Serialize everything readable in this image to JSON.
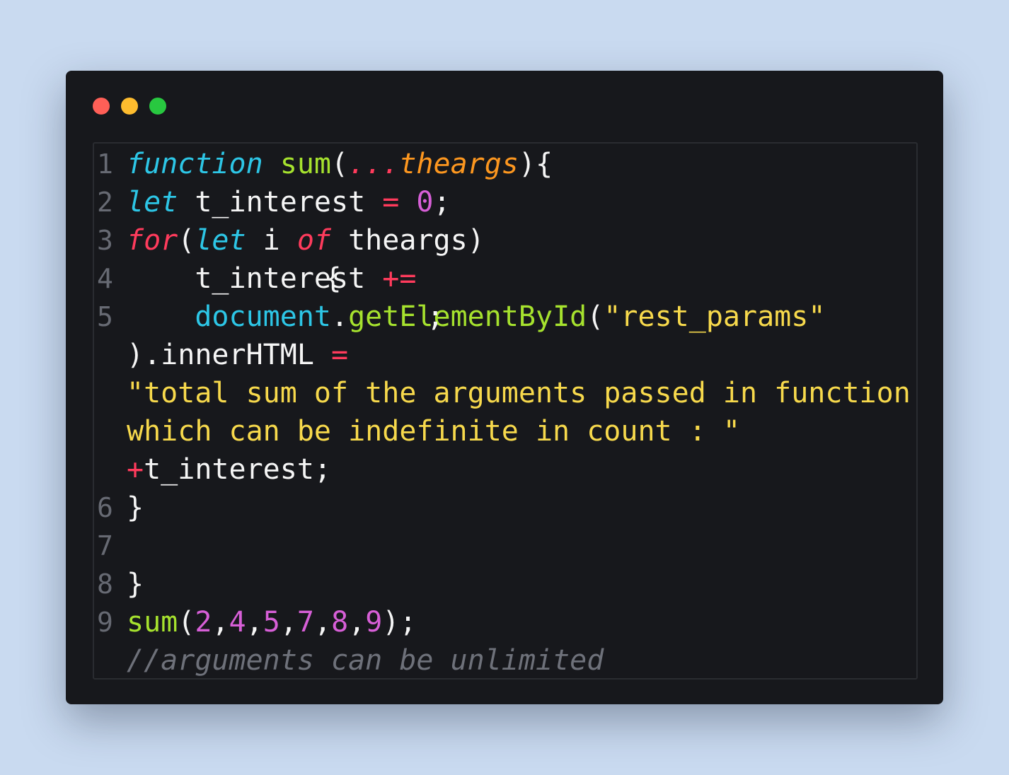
{
  "window": {
    "traffic_lights": [
      "#ff5f57",
      "#febc2e",
      "#28c840"
    ]
  },
  "colors": {
    "background": "#c9daf0",
    "window": "#17181c",
    "plain": "#f5f5f5",
    "keyword_cyan": "#2dc6e6",
    "keyword_red": "#ff3b5c",
    "function_green": "#a6e22e",
    "param_orange": "#fd971f",
    "number_purple": "#d75fd7",
    "string_yellow": "#f7d94c",
    "comment_gray": "#6e717a",
    "line_number": "#676a73"
  },
  "code": {
    "lines": [
      {
        "n": "1",
        "tokens": [
          {
            "t": "function",
            "c": "keyword_cyan",
            "i": true
          },
          {
            "t": " ",
            "c": "plain"
          },
          {
            "t": "sum",
            "c": "function_green"
          },
          {
            "t": "(",
            "c": "plain"
          },
          {
            "t": "...",
            "c": "keyword_red",
            "i": true
          },
          {
            "t": "theargs",
            "c": "param_orange",
            "i": true
          },
          {
            "t": "){",
            "c": "plain"
          }
        ]
      },
      {
        "n": "2",
        "tokens": [
          {
            "t": "let",
            "c": "keyword_cyan",
            "i": true
          },
          {
            "t": " t_interest ",
            "c": "plain"
          },
          {
            "t": "=",
            "c": "keyword_red"
          },
          {
            "t": " ",
            "c": "plain"
          },
          {
            "t": "0",
            "c": "number_purple"
          },
          {
            "t": ";",
            "c": "plain"
          }
        ]
      },
      {
        "n": "3",
        "tokens": [
          {
            "t": "for",
            "c": "keyword_red",
            "i": true
          },
          {
            "t": "(",
            "c": "plain"
          },
          {
            "t": "let",
            "c": "keyword_cyan",
            "i": true
          },
          {
            "t": " i ",
            "c": "plain"
          },
          {
            "t": "of",
            "c": "keyword_red",
            "i": true
          },
          {
            "t": " theargs)",
            "c": "plain"
          }
        ]
      },
      {
        "n": "4",
        "tokens": [
          {
            "t": "    t_interest ",
            "c": "plain"
          },
          {
            "t": "+=",
            "c": "keyword_red",
            "i": true
          }
        ]
      },
      {
        "n": "5",
        "tokens": [
          {
            "t": "    ",
            "c": "plain"
          },
          {
            "t": "document",
            "c": "keyword_cyan"
          },
          {
            "t": ".",
            "c": "plain"
          },
          {
            "t": "getElementById",
            "c": "function_green"
          },
          {
            "t": "(",
            "c": "plain"
          },
          {
            "t": "\"rest_params\"",
            "c": "string_yellow"
          }
        ]
      },
      {
        "n": "",
        "tokens": [
          {
            "t": ").innerHTML ",
            "c": "plain"
          },
          {
            "t": "=",
            "c": "keyword_red"
          }
        ]
      },
      {
        "n": "",
        "tokens": [
          {
            "t": "\"total sum of the arguments passed in function",
            "c": "string_yellow"
          }
        ]
      },
      {
        "n": "",
        "tokens": [
          {
            "t": "which can be indefinite in count : \"",
            "c": "string_yellow"
          }
        ]
      },
      {
        "n": "",
        "tokens": [
          {
            "t": "+",
            "c": "keyword_red",
            "i": true
          },
          {
            "t": "t_interest;",
            "c": "plain"
          }
        ]
      },
      {
        "n": "6",
        "tokens": [
          {
            "t": "}",
            "c": "plain"
          }
        ]
      },
      {
        "n": "7",
        "tokens": []
      },
      {
        "n": "8",
        "tokens": [
          {
            "t": "}",
            "c": "plain"
          }
        ]
      },
      {
        "n": "9",
        "tokens": [
          {
            "t": "sum",
            "c": "function_green"
          },
          {
            "t": "(",
            "c": "plain"
          },
          {
            "t": "2",
            "c": "number_purple"
          },
          {
            "t": ",",
            "c": "plain"
          },
          {
            "t": "4",
            "c": "number_purple"
          },
          {
            "t": ",",
            "c": "plain"
          },
          {
            "t": "5",
            "c": "number_purple"
          },
          {
            "t": ",",
            "c": "plain"
          },
          {
            "t": "7",
            "c": "number_purple"
          },
          {
            "t": ",",
            "c": "plain"
          },
          {
            "t": "8",
            "c": "number_purple"
          },
          {
            "t": ",",
            "c": "plain"
          },
          {
            "t": "9",
            "c": "number_purple"
          },
          {
            "t": ");",
            "c": "plain"
          }
        ]
      },
      {
        "n": "",
        "tokens": [
          {
            "t": "//arguments can be unlimited",
            "c": "comment_gray",
            "i": true
          }
        ]
      }
    ],
    "overlays": [
      {
        "t": "{",
        "c": "plain"
      },
      {
        "t": ";",
        "c": "plain"
      }
    ]
  }
}
